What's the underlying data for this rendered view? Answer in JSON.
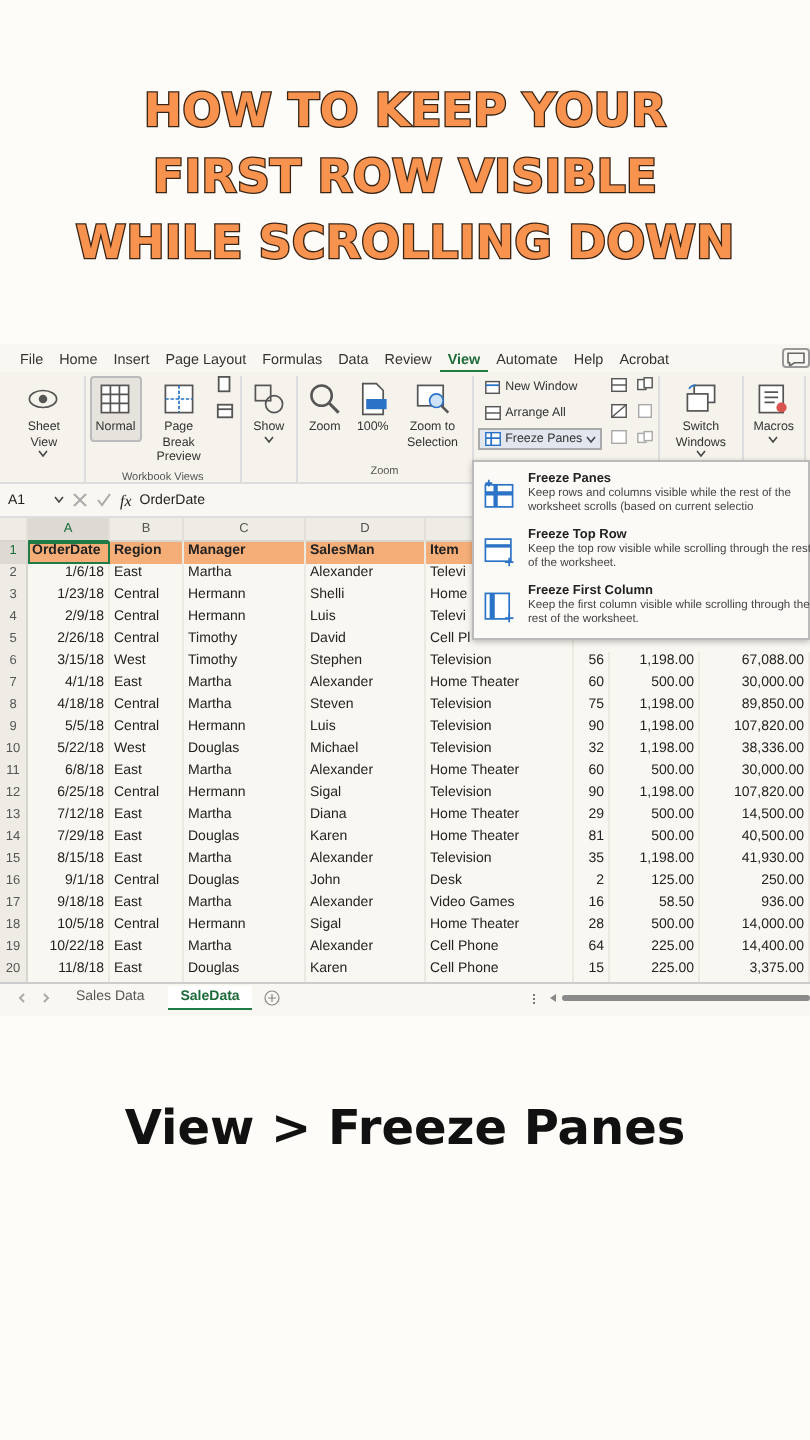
{
  "title_lines": [
    "HOW TO KEEP YOUR",
    "FIRST ROW VISIBLE",
    "WHILE SCROLLING DOWN"
  ],
  "ribbon": {
    "tabs": [
      {
        "label": "File",
        "selected": false
      },
      {
        "label": "Home",
        "selected": false
      },
      {
        "label": "Insert",
        "selected": false
      },
      {
        "label": "Page Layout",
        "selected": false
      },
      {
        "label": "Formulas",
        "selected": false
      },
      {
        "label": "Data",
        "selected": false
      },
      {
        "label": "Review",
        "selected": false
      },
      {
        "label": "View",
        "selected": true
      },
      {
        "label": "Automate",
        "selected": false
      },
      {
        "label": "Help",
        "selected": false
      },
      {
        "label": "Acrobat",
        "selected": false
      }
    ],
    "groups": [
      {
        "items": [
          {
            "kind": "large",
            "label": "Sheet View",
            "dropdown": true,
            "selected": false
          }
        ]
      },
      {
        "label": "Workbook Views",
        "items": [
          {
            "kind": "large",
            "label": "Normal",
            "dropdown": false,
            "selected": true
          },
          {
            "kind": "large",
            "label": "Page Break Preview",
            "dropdown": false,
            "selected": false
          },
          {
            "kind": "icon",
            "selected": false
          },
          {
            "kind": "icon",
            "selected": false
          }
        ]
      },
      {
        "items": [
          {
            "kind": "large",
            "label": "Show",
            "dropdown": true,
            "selected": false
          }
        ]
      },
      {
        "label": "Zoom",
        "items": [
          {
            "kind": "large",
            "label": "Zoom",
            "dropdown": false,
            "selected": false
          },
          {
            "kind": "large",
            "label": "100%",
            "dropdown": false,
            "selected": false
          },
          {
            "kind": "large",
            "label": "Zoom to Selection",
            "dropdown": false,
            "selected": false
          }
        ]
      },
      {
        "items": [
          {
            "kind": "small",
            "label": "New Window",
            "dropdown": false,
            "selected": false
          },
          {
            "kind": "small",
            "label": "Arrange All",
            "dropdown": false,
            "selected": false
          },
          {
            "kind": "small",
            "label": "Freeze Panes",
            "dropdown": true,
            "selected": true
          },
          {
            "kind": "icon",
            "selected": false
          },
          {
            "kind": "icon",
            "selected": false
          },
          {
            "kind": "icon",
            "selected": false
          },
          {
            "kind": "icon",
            "selected": false
          },
          {
            "kind": "icon",
            "selected": false
          },
          {
            "kind": "icon",
            "selected": false
          }
        ]
      },
      {
        "items": [
          {
            "kind": "large",
            "label": "Switch Windows",
            "dropdown": true,
            "selected": false
          }
        ]
      },
      {
        "items": [
          {
            "kind": "large",
            "label": "Macros",
            "dropdown": true,
            "selected": false
          }
        ]
      }
    ]
  },
  "freeze_menu": [
    {
      "title": "Freeze Panes",
      "description": "Keep rows and columns visible while the rest of the worksheet scrolls (based on current selectio"
    },
    {
      "title": "Freeze Top Row",
      "description": "Keep the top row visible while scrolling through the rest of the worksheet."
    },
    {
      "title": "Freeze First Column",
      "description": "Keep the first column visible while scrolling through the rest of the worksheet."
    }
  ],
  "formula_bar": {
    "name_box": "A1",
    "function_label": "fx",
    "formula": "OrderDate"
  },
  "sheet": {
    "column_headers": [
      {
        "label": "A",
        "selected": true
      },
      {
        "label": "B",
        "selected": false
      },
      {
        "label": "C",
        "selected": false
      },
      {
        "label": "D",
        "selected": false
      }
    ],
    "rows": [
      {
        "number": "1",
        "kind": "header",
        "selected": true,
        "cells": [
          "OrderDate",
          "Region",
          "Manager",
          "SalesMan",
          "Item"
        ]
      },
      {
        "number": "2",
        "kind": "data",
        "selected": false,
        "cells": [
          "1/6/18",
          "East",
          "Martha",
          "Alexander",
          "Televi"
        ]
      },
      {
        "number": "3",
        "kind": "data",
        "selected": false,
        "cells": [
          "1/23/18",
          "Central",
          "Hermann",
          "Shelli",
          "Home"
        ]
      },
      {
        "number": "4",
        "kind": "data",
        "selected": false,
        "cells": [
          "2/9/18",
          "Central",
          "Hermann",
          "Luis",
          "Televi"
        ]
      },
      {
        "number": "5",
        "kind": "data",
        "selected": false,
        "cells": [
          "2/26/18",
          "Central",
          "Timothy",
          "David",
          "Cell Pl"
        ]
      },
      {
        "number": "6",
        "kind": "data",
        "selected": false,
        "cells": [
          "3/15/18",
          "West",
          "Timothy",
          "Stephen",
          "Television",
          "56",
          "1,198.00",
          "67,088.00"
        ]
      },
      {
        "number": "7",
        "kind": "data",
        "selected": false,
        "cells": [
          "4/1/18",
          "East",
          "Martha",
          "Alexander",
          "Home Theater",
          "60",
          "500.00",
          "30,000.00"
        ]
      },
      {
        "number": "8",
        "kind": "data",
        "selected": false,
        "cells": [
          "4/18/18",
          "Central",
          "Martha",
          "Steven",
          "Television",
          "75",
          "1,198.00",
          "89,850.00"
        ]
      },
      {
        "number": "9",
        "kind": "data",
        "selected": false,
        "cells": [
          "5/5/18",
          "Central",
          "Hermann",
          "Luis",
          "Television",
          "90",
          "1,198.00",
          "107,820.00"
        ]
      },
      {
        "number": "10",
        "kind": "data",
        "selected": false,
        "cells": [
          "5/22/18",
          "West",
          "Douglas",
          "Michael",
          "Television",
          "32",
          "1,198.00",
          "38,336.00"
        ]
      },
      {
        "number": "11",
        "kind": "data",
        "selected": false,
        "cells": [
          "6/8/18",
          "East",
          "Martha",
          "Alexander",
          "Home Theater",
          "60",
          "500.00",
          "30,000.00"
        ]
      },
      {
        "number": "12",
        "kind": "data",
        "selected": false,
        "cells": [
          "6/25/18",
          "Central",
          "Hermann",
          "Sigal",
          "Television",
          "90",
          "1,198.00",
          "107,820.00"
        ]
      },
      {
        "number": "13",
        "kind": "data",
        "selected": false,
        "cells": [
          "7/12/18",
          "East",
          "Martha",
          "Diana",
          "Home Theater",
          "29",
          "500.00",
          "14,500.00"
        ]
      },
      {
        "number": "14",
        "kind": "data",
        "selected": false,
        "cells": [
          "7/29/18",
          "East",
          "Douglas",
          "Karen",
          "Home Theater",
          "81",
          "500.00",
          "40,500.00"
        ]
      },
      {
        "number": "15",
        "kind": "data",
        "selected": false,
        "cells": [
          "8/15/18",
          "East",
          "Martha",
          "Alexander",
          "Television",
          "35",
          "1,198.00",
          "41,930.00"
        ]
      },
      {
        "number": "16",
        "kind": "data",
        "selected": false,
        "cells": [
          "9/1/18",
          "Central",
          "Douglas",
          "John",
          "Desk",
          "2",
          "125.00",
          "250.00"
        ]
      },
      {
        "number": "17",
        "kind": "data",
        "selected": false,
        "cells": [
          "9/18/18",
          "East",
          "Martha",
          "Alexander",
          "Video Games",
          "16",
          "58.50",
          "936.00"
        ]
      },
      {
        "number": "18",
        "kind": "data",
        "selected": false,
        "cells": [
          "10/5/18",
          "Central",
          "Hermann",
          "Sigal",
          "Home Theater",
          "28",
          "500.00",
          "14,000.00"
        ]
      },
      {
        "number": "19",
        "kind": "data",
        "selected": false,
        "cells": [
          "10/22/18",
          "East",
          "Martha",
          "Alexander",
          "Cell Phone",
          "64",
          "225.00",
          "14,400.00"
        ]
      },
      {
        "number": "20",
        "kind": "data",
        "selected": false,
        "cells": [
          "11/8/18",
          "East",
          "Douglas",
          "Karen",
          "Cell Phone",
          "15",
          "225.00",
          "3,375.00"
        ]
      }
    ]
  },
  "sheet_tabs": [
    {
      "label": "Sales Data",
      "selected": false
    },
    {
      "label": "SaleData",
      "selected": true
    }
  ],
  "caption": "View > Freeze Panes"
}
